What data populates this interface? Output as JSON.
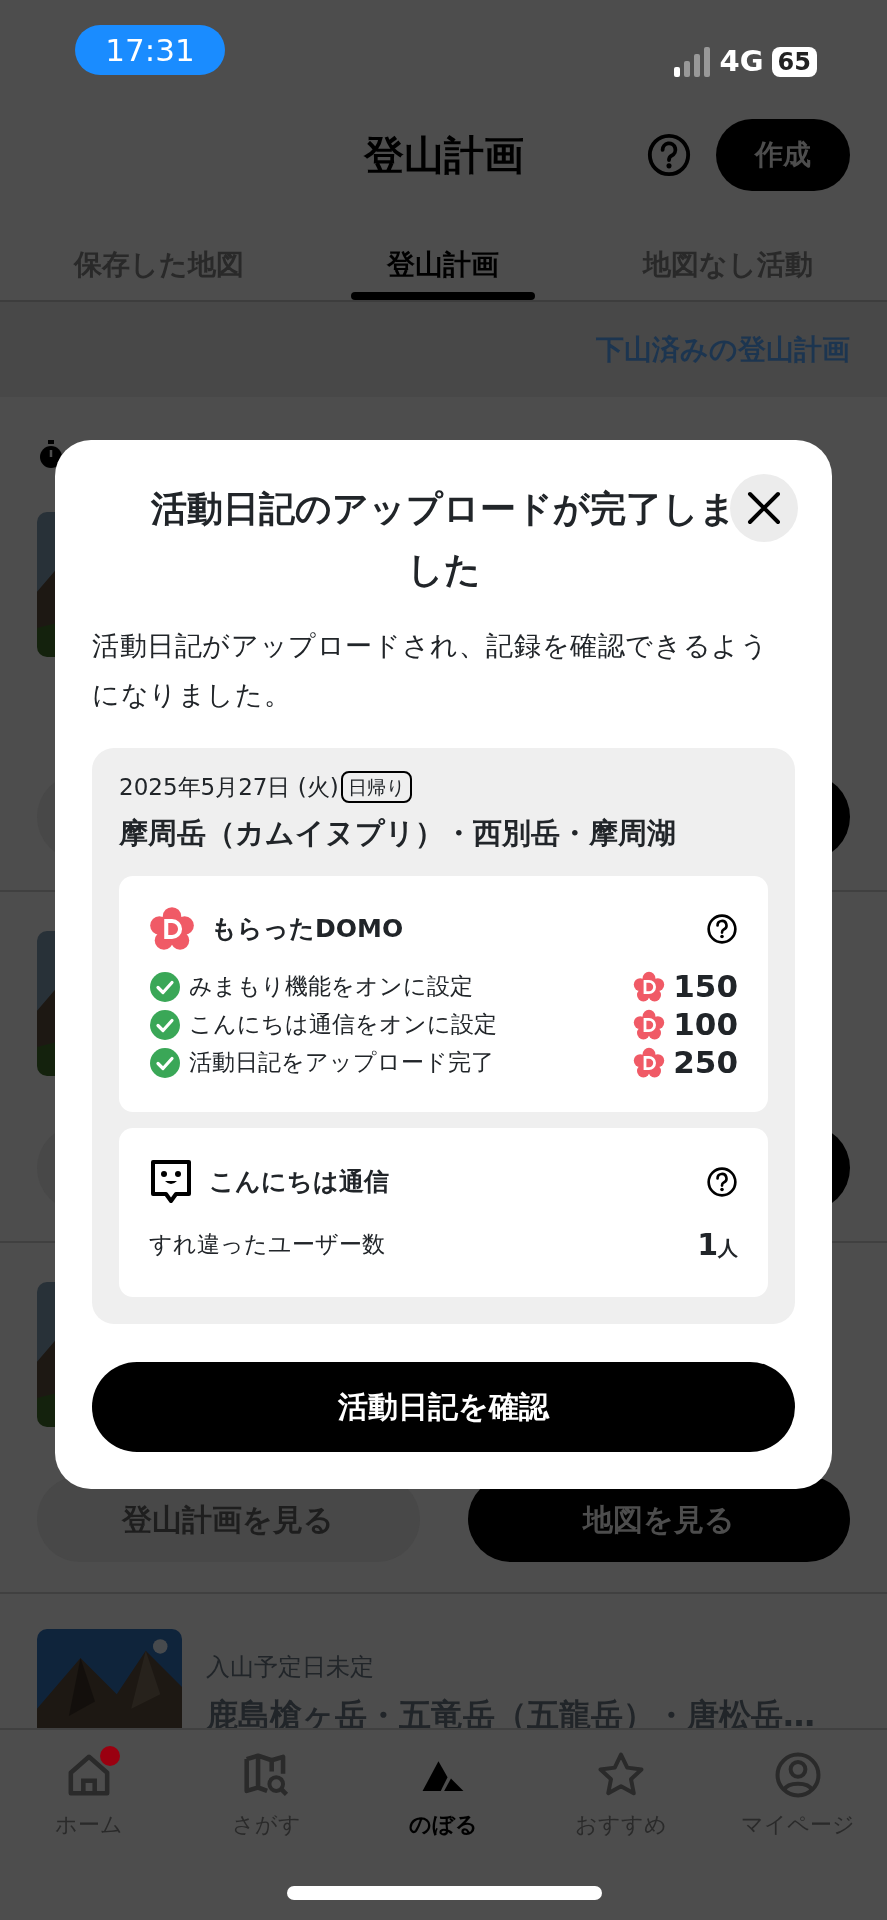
{
  "status_bar": {
    "time": "17:31",
    "network": "4G",
    "battery": "65"
  },
  "header": {
    "title": "登山計画",
    "create_button": "作成"
  },
  "tabs": [
    {
      "label": "保存した地図",
      "selected": false
    },
    {
      "label": "登山計画",
      "selected": true
    },
    {
      "label": "地図なし活動",
      "selected": false
    }
  ],
  "completed_link": "下山済みの登山計画",
  "plans": [
    {
      "timer": true
    },
    {
      "timer": false
    },
    {
      "timer": false,
      "buttons": [
        "登山計画を見る",
        "地図を見る"
      ]
    },
    {
      "timer": false,
      "date_label": "入山予定日未定",
      "title": "鹿島槍ヶ岳・五竜岳（五龍岳）・唐松岳…"
    }
  ],
  "dialog": {
    "title": "活動日記のアップロードが完了しました",
    "message": "活動日記がアップロードされ、記録を確認できるようになりました。",
    "activity": {
      "date": "2025年5月27日 (火)",
      "badge": "日帰り",
      "route": "摩周岳（カムイヌプリ）・西別岳・摩周湖"
    },
    "domo": {
      "title": "もらったDOMO",
      "items": [
        {
          "label": "みまもり機能をオンに設定",
          "points": "150",
          "checked": true
        },
        {
          "label": "こんにちは通信をオンに設定",
          "points": "100",
          "checked": true
        },
        {
          "label": "活動日記をアップロード完了",
          "points": "250",
          "checked": true
        }
      ]
    },
    "encounter": {
      "title": "こんにちは通信",
      "label": "すれ違ったユーザー数",
      "value": "1",
      "unit": "人"
    },
    "confirm_button": "活動日記を確認"
  },
  "tab_bar": [
    {
      "label": "ホーム",
      "selected": false,
      "notification": true
    },
    {
      "label": "さがす",
      "selected": false,
      "notification": false
    },
    {
      "label": "のぼる",
      "selected": true,
      "notification": false
    },
    {
      "label": "おすすめ",
      "selected": false,
      "notification": false
    },
    {
      "label": "マイページ",
      "selected": false,
      "notification": false
    }
  ]
}
